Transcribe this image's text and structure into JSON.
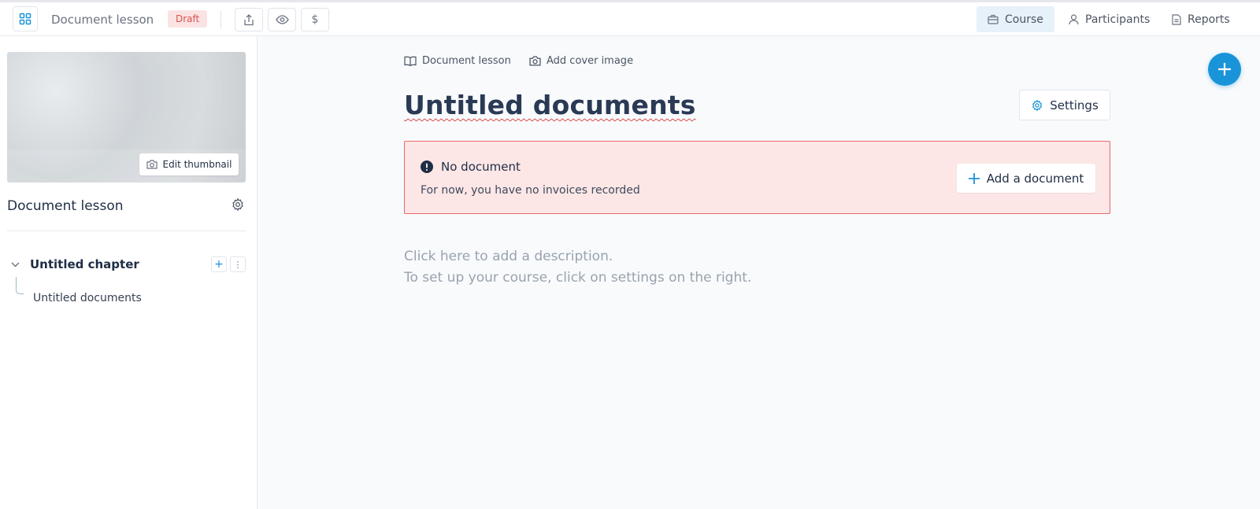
{
  "topbar": {
    "title": "Document lesson",
    "status_badge": "Draft",
    "nav": [
      {
        "label": "Course",
        "active": true,
        "icon": "briefcase-icon"
      },
      {
        "label": "Participants",
        "active": false,
        "icon": "user-icon"
      },
      {
        "label": "Reports",
        "active": false,
        "icon": "document-icon"
      }
    ],
    "tools": [
      {
        "icon": "share-icon"
      },
      {
        "icon": "eye-icon"
      },
      {
        "icon": "dollar-icon",
        "glyph": "$"
      }
    ]
  },
  "sidebar": {
    "edit_thumbnail_label": "Edit thumbnail",
    "lesson_title": "Document lesson",
    "chapter": {
      "title": "Untitled chapter",
      "items": [
        {
          "label": "Untitled documents"
        }
      ]
    }
  },
  "main": {
    "meta_type": "Document lesson",
    "meta_cover": "Add cover image",
    "title": "Untitled documents",
    "settings_label": "Settings",
    "alert": {
      "heading": "No document",
      "body": "For now, you have no invoices recorded",
      "action_label": "Add a document"
    },
    "description_line1": "Click here to add a description.",
    "description_line2": "To set up your course, click on settings on the right."
  },
  "colors": {
    "accent": "#1a94d8",
    "alert_bg": "#fce6e6",
    "alert_border": "#e56b6b",
    "draft_bg": "#fbe3e3",
    "draft_text": "#d9534f",
    "nav_active_bg": "#e6f1fa"
  }
}
